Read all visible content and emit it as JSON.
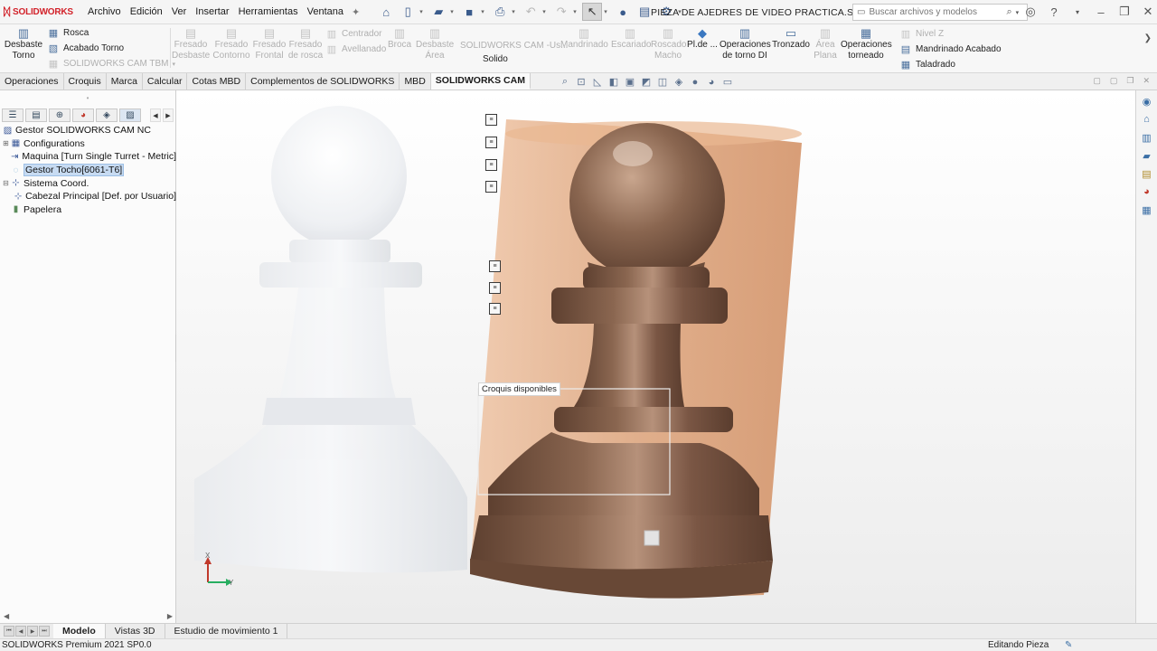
{
  "app": {
    "brand": "SOLIDWORKS",
    "document_title": "PIEZA DE AJEDRES DE VIDEO PRACTICA.SLDPRT"
  },
  "menu": [
    "Archivo",
    "Edición",
    "Ver",
    "Insertar",
    "Herramientas",
    "Ventana"
  ],
  "search": {
    "placeholder": "Buscar archivos y modelos"
  },
  "ribbon": {
    "desbaste_torno": "Desbaste\nTorno",
    "rosca": "Rosca",
    "acabado_torno": "Acabado Torno",
    "cam_tbm": "SOLIDWORKS CAM TBM",
    "fresado_desbaste": "Fresado\nDesbaste",
    "fresado_contorno": "Fresado\nContorno",
    "fresado_frontal": "Fresado\nFrontal",
    "fresado_rosca": "Fresado\nde rosca",
    "centrador": "Centrador",
    "avellanado": "Avellanado",
    "broca": "Broca",
    "desbaste_area": "Desbaste\nÁrea",
    "cam_us": "SOLIDWORKS CAM -Us...",
    "solido": "Solido",
    "mandrinado": "Mandrinado",
    "escariado": "Escariado",
    "roscado_macho": "Roscado\nMacho",
    "pl_de": "Pl.de ...",
    "operaciones_torno_di": "Operaciones\nde torno DI",
    "tronzado": "Tronzado",
    "area_plana": "Área\nPlana",
    "operaciones_torneado": "Operaciones\ntorneado",
    "nivel_z": "Nivel Z",
    "mandrinado_acabado": "Mandrinado Acabado",
    "taladrado": "Taladrado"
  },
  "tabs": [
    "Operaciones",
    "Croquis",
    "Marca",
    "Calcular",
    "Cotas MBD",
    "Complementos de SOLIDWORKS",
    "MBD",
    "SOLIDWORKS CAM"
  ],
  "active_tab": "SOLIDWORKS CAM",
  "tree": {
    "root": "Gestor SOLIDWORKS CAM NC",
    "configurations": "Configurations",
    "maquina": "Maquina [Turn Single Turret - Metric]",
    "gestor_tocho": "Gestor Tocho[6061-T6]",
    "sistema_coord": "Sistema Coord.",
    "cabezal": "Cabezal Principal [Def. por Usuario]",
    "papelera": "Papelera"
  },
  "viewport": {
    "sketch_tooltip": "Croquis disponibles",
    "triad_x": "X",
    "triad_y": "Y"
  },
  "bottom_tabs": [
    "Modelo",
    "Vistas 3D",
    "Estudio de movimiento 1"
  ],
  "active_bottom_tab": "Modelo",
  "status": {
    "version": "SOLIDWORKS Premium 2021 SP0.0",
    "mode": "Editando Pieza"
  },
  "colors": {
    "brand": "#d2222a",
    "pawn": "#7b5844",
    "stock": "#d79a6e",
    "selection": "#c7dbf2"
  }
}
